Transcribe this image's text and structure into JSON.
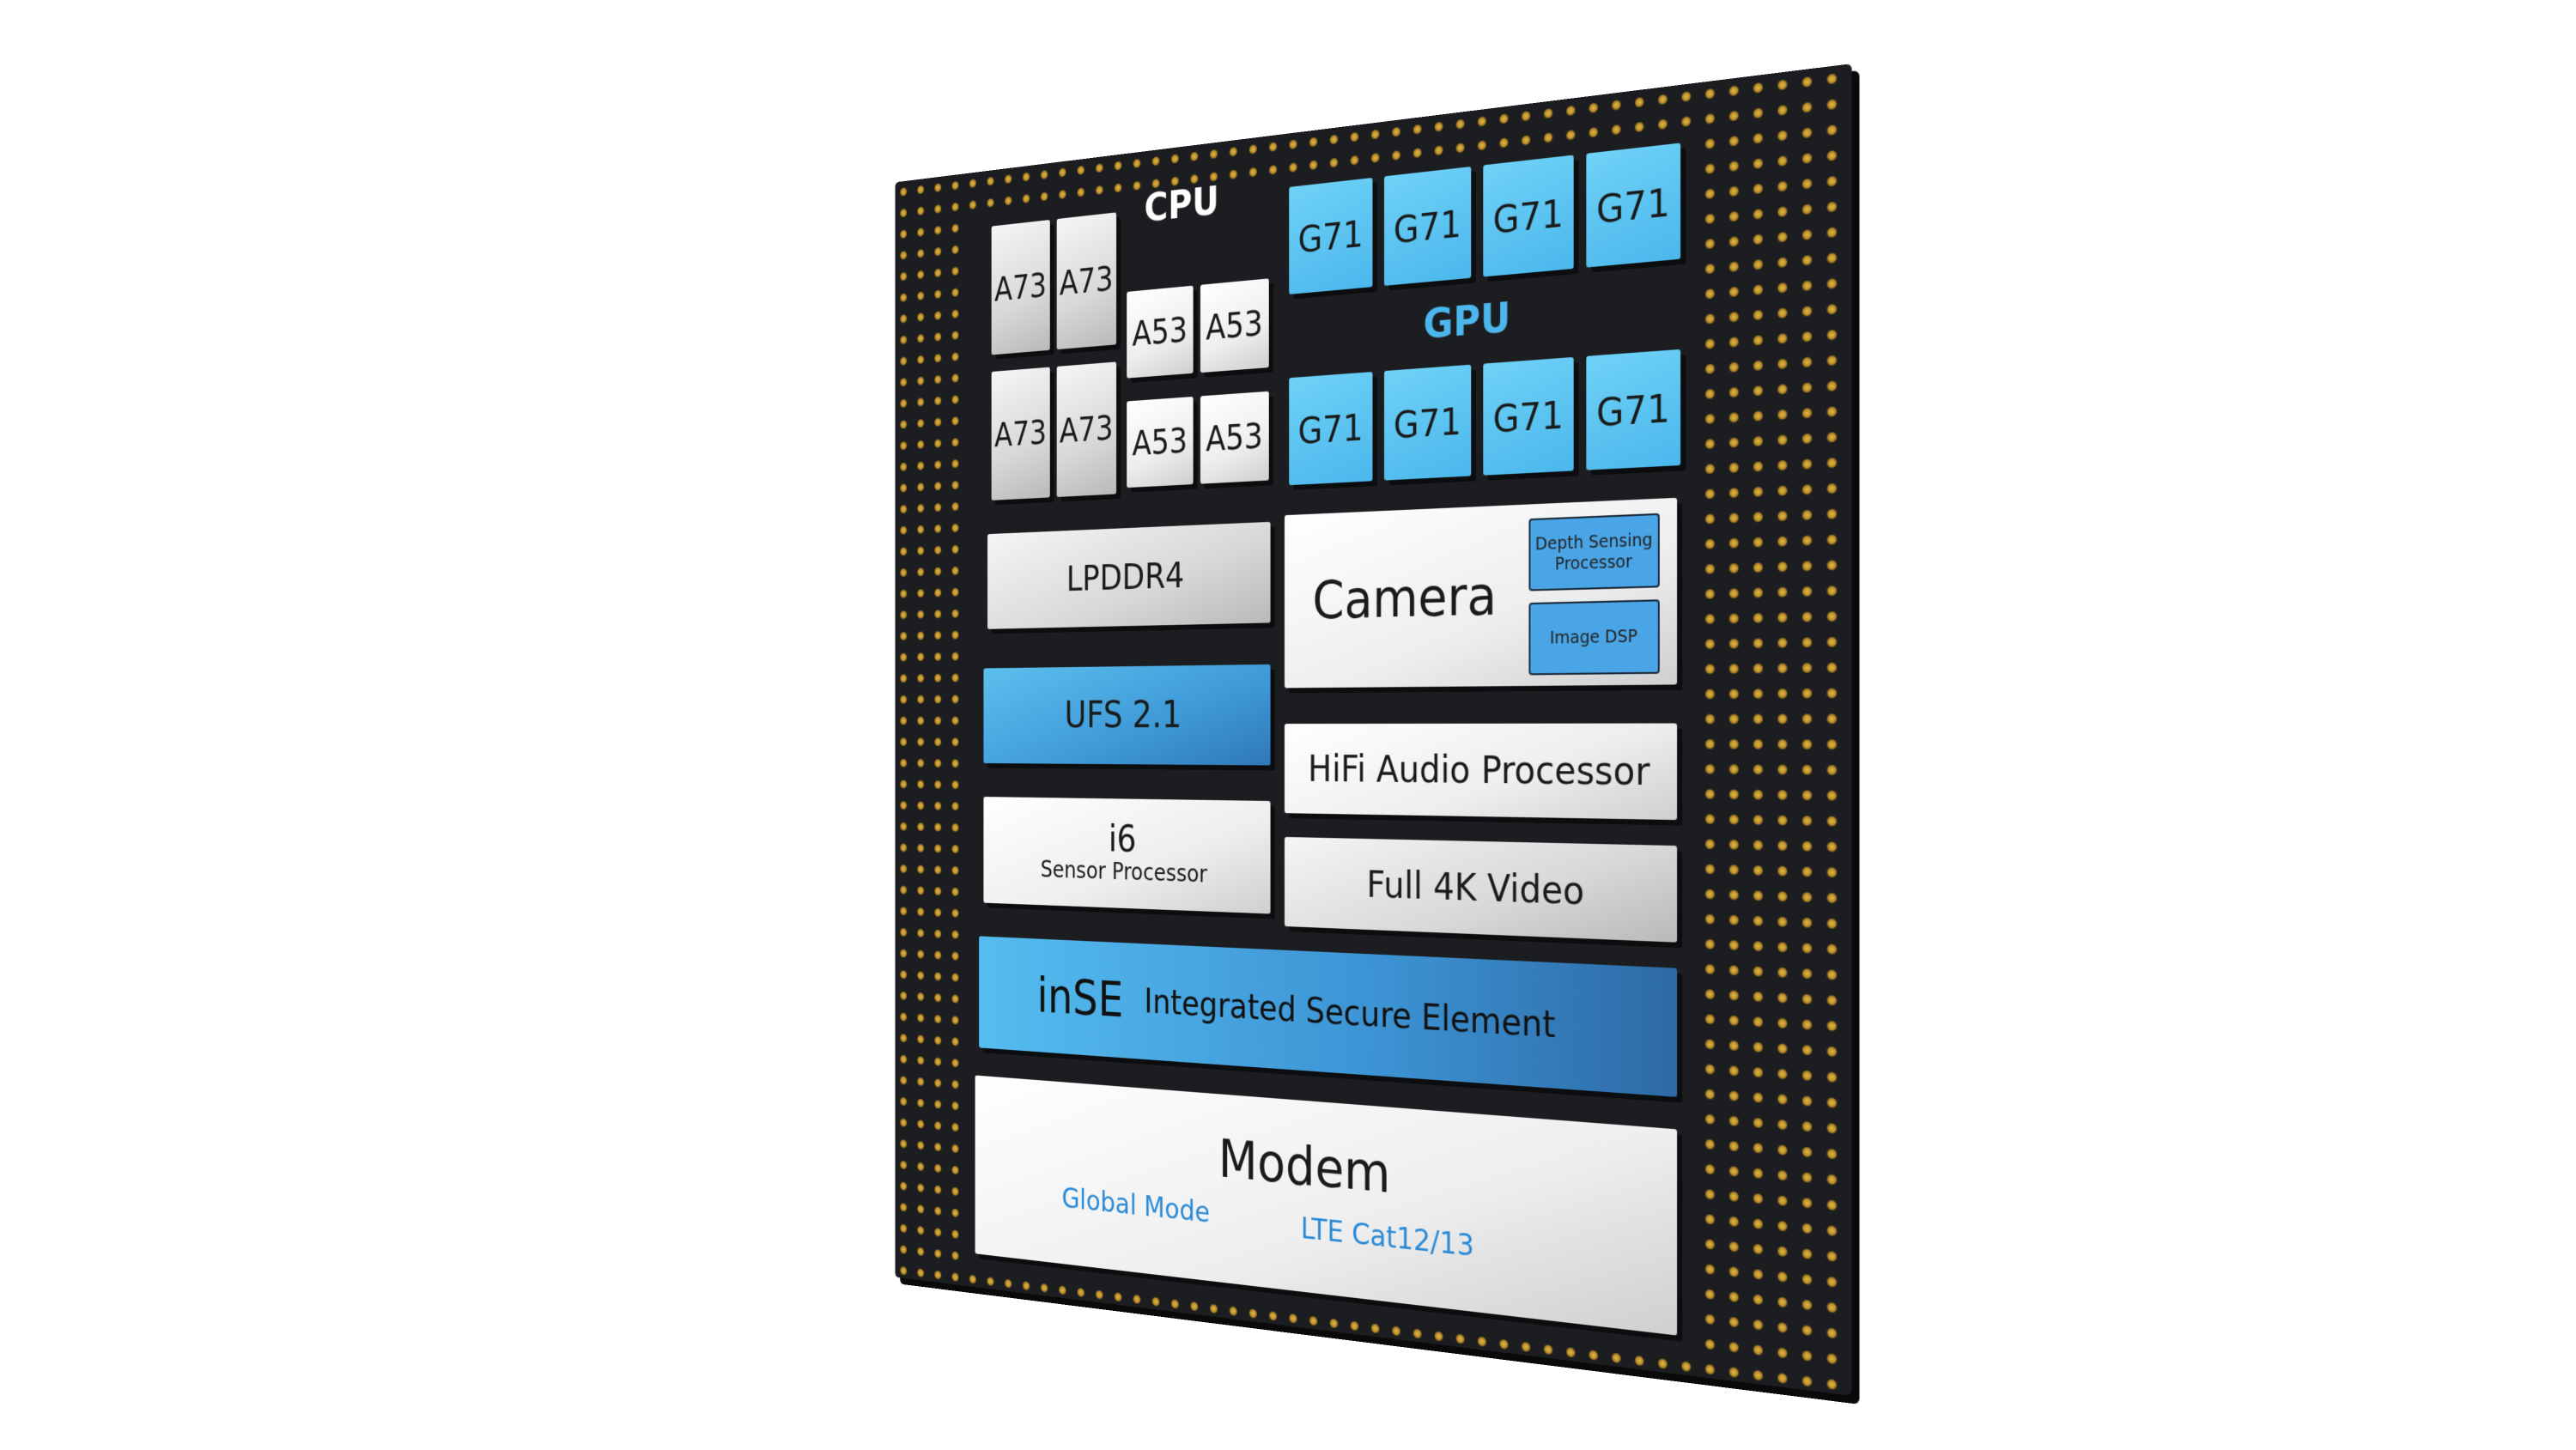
{
  "cpu": {
    "label": "CPU",
    "big_cores": [
      "A73",
      "A73",
      "A73",
      "A73"
    ],
    "little_cores": [
      "A53",
      "A53",
      "A53",
      "A53"
    ]
  },
  "gpu": {
    "label": "GPU",
    "cores": [
      "G71",
      "G71",
      "G71",
      "G71",
      "G71",
      "G71",
      "G71",
      "G71"
    ]
  },
  "memory": {
    "label": "LPDDR4"
  },
  "storage": {
    "label": "UFS 2.1"
  },
  "camera": {
    "label": "Camera",
    "depth": "Depth Sensing Processor",
    "dsp": "Image DSP"
  },
  "audio": {
    "label": "HiFi Audio Processor"
  },
  "sensor": {
    "title": "i6",
    "subtitle": "Sensor Processor"
  },
  "video": {
    "label": "Full 4K Video"
  },
  "secure": {
    "title": "inSE",
    "subtitle": "Integrated Secure Element"
  },
  "modem": {
    "title": "Modem",
    "mode": "Global Mode",
    "lte": "LTE Cat12/13"
  },
  "colors": {
    "chip": "#1c1d20",
    "pins": "#d4a93a",
    "blue": "#3f9ad8",
    "cyan": "#4bb7ec",
    "modem_text": "#2a8ad6"
  }
}
